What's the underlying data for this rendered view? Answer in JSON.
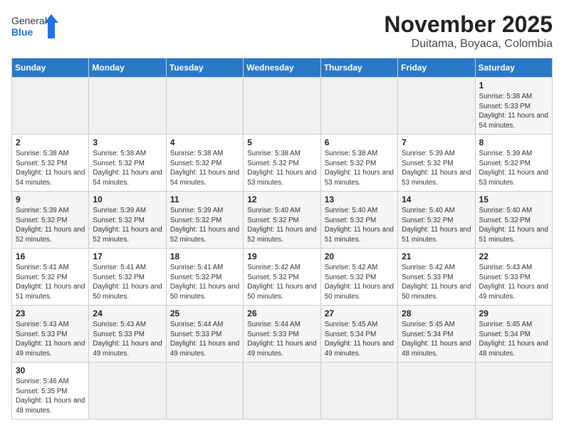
{
  "header": {
    "logo_general": "General",
    "logo_blue": "Blue",
    "month": "November 2025",
    "location": "Duitama, Boyaca, Colombia"
  },
  "days_of_week": [
    "Sunday",
    "Monday",
    "Tuesday",
    "Wednesday",
    "Thursday",
    "Friday",
    "Saturday"
  ],
  "weeks": [
    [
      null,
      null,
      null,
      null,
      null,
      null,
      {
        "day": "1",
        "sunrise": "Sunrise: 5:38 AM",
        "sunset": "Sunset: 5:33 PM",
        "daylight": "Daylight: 11 hours and 54 minutes."
      }
    ],
    [
      {
        "day": "2",
        "sunrise": "Sunrise: 5:38 AM",
        "sunset": "Sunset: 5:32 PM",
        "daylight": "Daylight: 11 hours and 54 minutes."
      },
      {
        "day": "3",
        "sunrise": "Sunrise: 5:38 AM",
        "sunset": "Sunset: 5:32 PM",
        "daylight": "Daylight: 11 hours and 54 minutes."
      },
      {
        "day": "4",
        "sunrise": "Sunrise: 5:38 AM",
        "sunset": "Sunset: 5:32 PM",
        "daylight": "Daylight: 11 hours and 54 minutes."
      },
      {
        "day": "5",
        "sunrise": "Sunrise: 5:38 AM",
        "sunset": "Sunset: 5:32 PM",
        "daylight": "Daylight: 11 hours and 53 minutes."
      },
      {
        "day": "6",
        "sunrise": "Sunrise: 5:38 AM",
        "sunset": "Sunset: 5:32 PM",
        "daylight": "Daylight: 11 hours and 53 minutes."
      },
      {
        "day": "7",
        "sunrise": "Sunrise: 5:39 AM",
        "sunset": "Sunset: 5:32 PM",
        "daylight": "Daylight: 11 hours and 53 minutes."
      },
      {
        "day": "8",
        "sunrise": "Sunrise: 5:39 AM",
        "sunset": "Sunset: 5:32 PM",
        "daylight": "Daylight: 11 hours and 53 minutes."
      }
    ],
    [
      {
        "day": "9",
        "sunrise": "Sunrise: 5:39 AM",
        "sunset": "Sunset: 5:32 PM",
        "daylight": "Daylight: 11 hours and 52 minutes."
      },
      {
        "day": "10",
        "sunrise": "Sunrise: 5:39 AM",
        "sunset": "Sunset: 5:32 PM",
        "daylight": "Daylight: 11 hours and 52 minutes."
      },
      {
        "day": "11",
        "sunrise": "Sunrise: 5:39 AM",
        "sunset": "Sunset: 5:32 PM",
        "daylight": "Daylight: 11 hours and 52 minutes."
      },
      {
        "day": "12",
        "sunrise": "Sunrise: 5:40 AM",
        "sunset": "Sunset: 5:32 PM",
        "daylight": "Daylight: 11 hours and 52 minutes."
      },
      {
        "day": "13",
        "sunrise": "Sunrise: 5:40 AM",
        "sunset": "Sunset: 5:32 PM",
        "daylight": "Daylight: 11 hours and 51 minutes."
      },
      {
        "day": "14",
        "sunrise": "Sunrise: 5:40 AM",
        "sunset": "Sunset: 5:32 PM",
        "daylight": "Daylight: 11 hours and 51 minutes."
      },
      {
        "day": "15",
        "sunrise": "Sunrise: 5:40 AM",
        "sunset": "Sunset: 5:32 PM",
        "daylight": "Daylight: 11 hours and 51 minutes."
      }
    ],
    [
      {
        "day": "16",
        "sunrise": "Sunrise: 5:41 AM",
        "sunset": "Sunset: 5:32 PM",
        "daylight": "Daylight: 11 hours and 51 minutes."
      },
      {
        "day": "17",
        "sunrise": "Sunrise: 5:41 AM",
        "sunset": "Sunset: 5:32 PM",
        "daylight": "Daylight: 11 hours and 50 minutes."
      },
      {
        "day": "18",
        "sunrise": "Sunrise: 5:41 AM",
        "sunset": "Sunset: 5:32 PM",
        "daylight": "Daylight: 11 hours and 50 minutes."
      },
      {
        "day": "19",
        "sunrise": "Sunrise: 5:42 AM",
        "sunset": "Sunset: 5:32 PM",
        "daylight": "Daylight: 11 hours and 50 minutes."
      },
      {
        "day": "20",
        "sunrise": "Sunrise: 5:42 AM",
        "sunset": "Sunset: 5:32 PM",
        "daylight": "Daylight: 11 hours and 50 minutes."
      },
      {
        "day": "21",
        "sunrise": "Sunrise: 5:42 AM",
        "sunset": "Sunset: 5:33 PM",
        "daylight": "Daylight: 11 hours and 50 minutes."
      },
      {
        "day": "22",
        "sunrise": "Sunrise: 5:43 AM",
        "sunset": "Sunset: 5:33 PM",
        "daylight": "Daylight: 11 hours and 49 minutes."
      }
    ],
    [
      {
        "day": "23",
        "sunrise": "Sunrise: 5:43 AM",
        "sunset": "Sunset: 5:33 PM",
        "daylight": "Daylight: 11 hours and 49 minutes."
      },
      {
        "day": "24",
        "sunrise": "Sunrise: 5:43 AM",
        "sunset": "Sunset: 5:33 PM",
        "daylight": "Daylight: 11 hours and 49 minutes."
      },
      {
        "day": "25",
        "sunrise": "Sunrise: 5:44 AM",
        "sunset": "Sunset: 5:33 PM",
        "daylight": "Daylight: 11 hours and 49 minutes."
      },
      {
        "day": "26",
        "sunrise": "Sunrise: 5:44 AM",
        "sunset": "Sunset: 5:33 PM",
        "daylight": "Daylight: 11 hours and 49 minutes."
      },
      {
        "day": "27",
        "sunrise": "Sunrise: 5:45 AM",
        "sunset": "Sunset: 5:34 PM",
        "daylight": "Daylight: 11 hours and 49 minutes."
      },
      {
        "day": "28",
        "sunrise": "Sunrise: 5:45 AM",
        "sunset": "Sunset: 5:34 PM",
        "daylight": "Daylight: 11 hours and 48 minutes."
      },
      {
        "day": "29",
        "sunrise": "Sunrise: 5:45 AM",
        "sunset": "Sunset: 5:34 PM",
        "daylight": "Daylight: 11 hours and 48 minutes."
      }
    ],
    [
      {
        "day": "30",
        "sunrise": "Sunrise: 5:46 AM",
        "sunset": "Sunset: 5:35 PM",
        "daylight": "Daylight: 11 hours and 48 minutes."
      },
      null,
      null,
      null,
      null,
      null,
      null
    ]
  ]
}
